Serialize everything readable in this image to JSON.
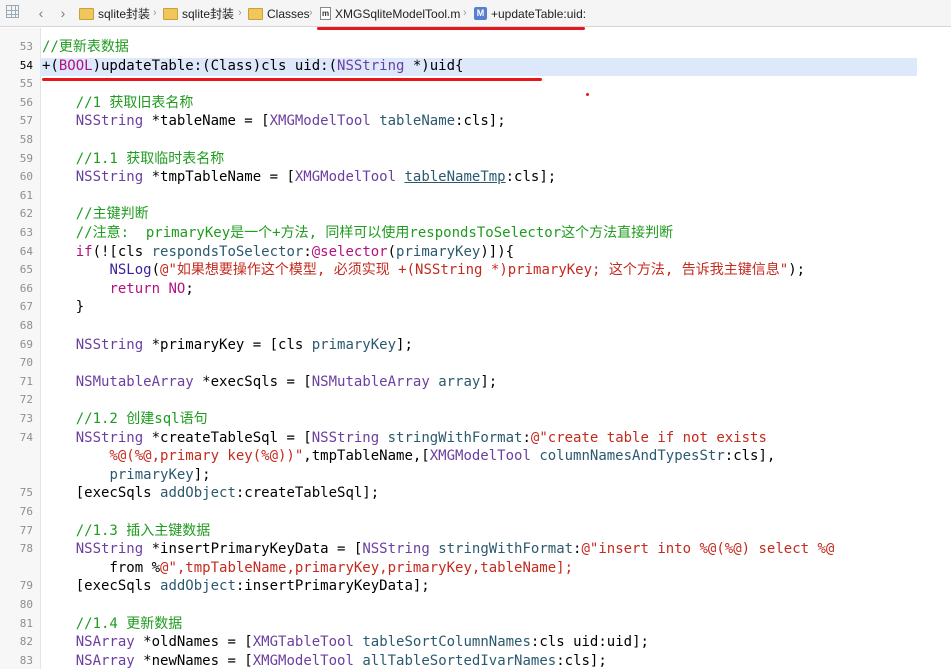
{
  "jumpbar": {
    "crumbs": [
      "sqlite封装",
      "sqlite封装",
      "Classes",
      "XMGSqliteModelTool.m",
      "+updateTable:uid:"
    ],
    "icons": [
      "grid-icon",
      "chevron-left-icon",
      "chevron-right-icon",
      "folder-icon",
      "folder-icon",
      "folder-icon",
      "m-file-icon",
      "method-icon"
    ]
  },
  "colors": {
    "annotation_red": "#e8161b",
    "comment_green": "#1f9c1f",
    "current_line": "#dde8fb"
  },
  "editor": {
    "current_line": 54,
    "lines": [
      {
        "n": "53",
        "t": "//更新表数据"
      },
      {
        "n": "54",
        "t": "+(BOOL)updateTable:(Class)cls uid:(NSString *)uid{"
      },
      {
        "n": "55",
        "t": ""
      },
      {
        "n": "56",
        "t": "    //1 获取旧表名称"
      },
      {
        "n": "57",
        "t": "    NSString *tableName = [XMGModelTool tableName:cls];"
      },
      {
        "n": "58",
        "t": ""
      },
      {
        "n": "59",
        "t": "    //1.1 获取临时表名称"
      },
      {
        "n": "60",
        "t": "    NSString *tmpTableName = [XMGModelTool tableNameTmp:cls];"
      },
      {
        "n": "61",
        "t": ""
      },
      {
        "n": "62",
        "t": "    //主键判断"
      },
      {
        "n": "63",
        "t": "    //注意:  primaryKey是一个+方法, 同样可以使用respondsToSelector这个方法直接判断"
      },
      {
        "n": "64",
        "t": "    if(![cls respondsToSelector:@selector(primaryKey)]){"
      },
      {
        "n": "65",
        "t": "        NSLog(@\"如果想要操作这个模型, 必须实现 +(NSString *)primaryKey; 这个方法, 告诉我主键信息\");"
      },
      {
        "n": "66",
        "t": "        return NO;"
      },
      {
        "n": "67",
        "t": "    }"
      },
      {
        "n": "68",
        "t": ""
      },
      {
        "n": "69",
        "t": "    NSString *primaryKey = [cls primaryKey];"
      },
      {
        "n": "70",
        "t": ""
      },
      {
        "n": "71",
        "t": "    NSMutableArray *execSqls = [NSMutableArray array];"
      },
      {
        "n": "72",
        "t": ""
      },
      {
        "n": "73",
        "t": "    //1.2 创建sql语句"
      },
      {
        "n": "74",
        "t": "    NSString *createTableSql = [NSString stringWithFormat:@\"create table if not exists"
      },
      {
        "n": "",
        "t": "        %@(%@,primary key(%@))\",tmpTableName,[XMGModelTool columnNamesAndTypesStr:cls],"
      },
      {
        "n": "",
        "t": "        primaryKey];"
      },
      {
        "n": "75",
        "t": "    [execSqls addObject:createTableSql];"
      },
      {
        "n": "76",
        "t": ""
      },
      {
        "n": "77",
        "t": "    //1.3 插入主键数据"
      },
      {
        "n": "78",
        "t": "    NSString *insertPrimaryKeyData = [NSString stringWithFormat:@\"insert into %@(%@) select %@"
      },
      {
        "n": "",
        "t": "        from %@\",tmpTableName,primaryKey,primaryKey,tableName];"
      },
      {
        "n": "79",
        "t": "    [execSqls addObject:insertPrimaryKeyData];"
      },
      {
        "n": "80",
        "t": ""
      },
      {
        "n": "81",
        "t": "    //1.4 更新数据"
      },
      {
        "n": "82",
        "t": "    NSArray *oldNames = [XMGTableTool tableSortColumnNames:cls uid:uid];"
      },
      {
        "n": "83",
        "t": "    NSArray *newNames = [XMGModelTool allTableSortedIvarNames:cls];"
      }
    ]
  }
}
